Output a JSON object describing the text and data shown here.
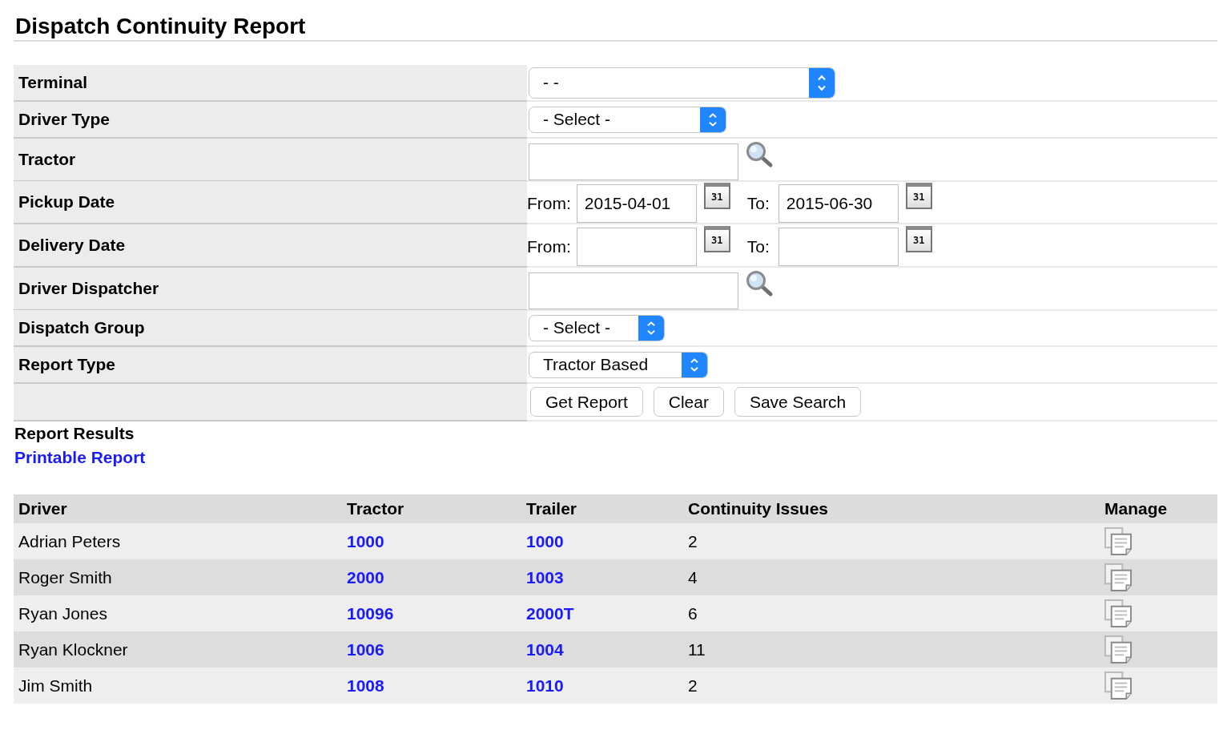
{
  "page_title": "Dispatch Continuity Report",
  "filters": [
    {
      "label": "Terminal",
      "kind": "select",
      "value": "- -"
    },
    {
      "label": "Driver Type",
      "kind": "select",
      "value": "- Select -"
    },
    {
      "label": "Tractor",
      "kind": "lookup"
    },
    {
      "label": "Pickup Date",
      "kind": "date_range",
      "from": {
        "label": "From:",
        "value": "2015-04-01",
        "calendar": "31"
      },
      "to": {
        "label": "To:",
        "value": "2015-06-30",
        "calendar": "31"
      }
    },
    {
      "label": "Delivery Date",
      "kind": "date_range",
      "from": {
        "label": "From:",
        "calendar": "31"
      },
      "to": {
        "label": "To:",
        "calendar": "31"
      }
    },
    {
      "label": "Driver Dispatcher",
      "kind": "lookup"
    },
    {
      "label": "Dispatch Group",
      "kind": "select",
      "value": "- Select -"
    },
    {
      "label": "Report Type",
      "kind": "select",
      "value": "Tractor Based"
    },
    {
      "kind": "buttons",
      "buttons": [
        "Get Report",
        "Clear",
        "Save Search"
      ]
    }
  ],
  "results": {
    "title": "Report Results",
    "printable_link": "Printable Report",
    "columns": [
      "Driver",
      "Tractor",
      "Trailer",
      "Continuity Issues",
      "Manage"
    ],
    "rows": [
      {
        "driver": "Adrian Peters",
        "tractor": "1000",
        "trailer": "1000",
        "continuity_issues": "2"
      },
      {
        "driver": "Roger Smith",
        "tractor": "2000",
        "trailer": "1003",
        "continuity_issues": "4"
      },
      {
        "driver": "Ryan Jones",
        "tractor": "10096",
        "trailer": "2000T",
        "continuity_issues": "6"
      },
      {
        "driver": "Ryan Klockner",
        "tractor": "1006",
        "trailer": "1004",
        "continuity_issues": "11"
      },
      {
        "driver": "Jim Smith",
        "tractor": "1008",
        "trailer": "1010",
        "continuity_issues": "2"
      }
    ]
  }
}
